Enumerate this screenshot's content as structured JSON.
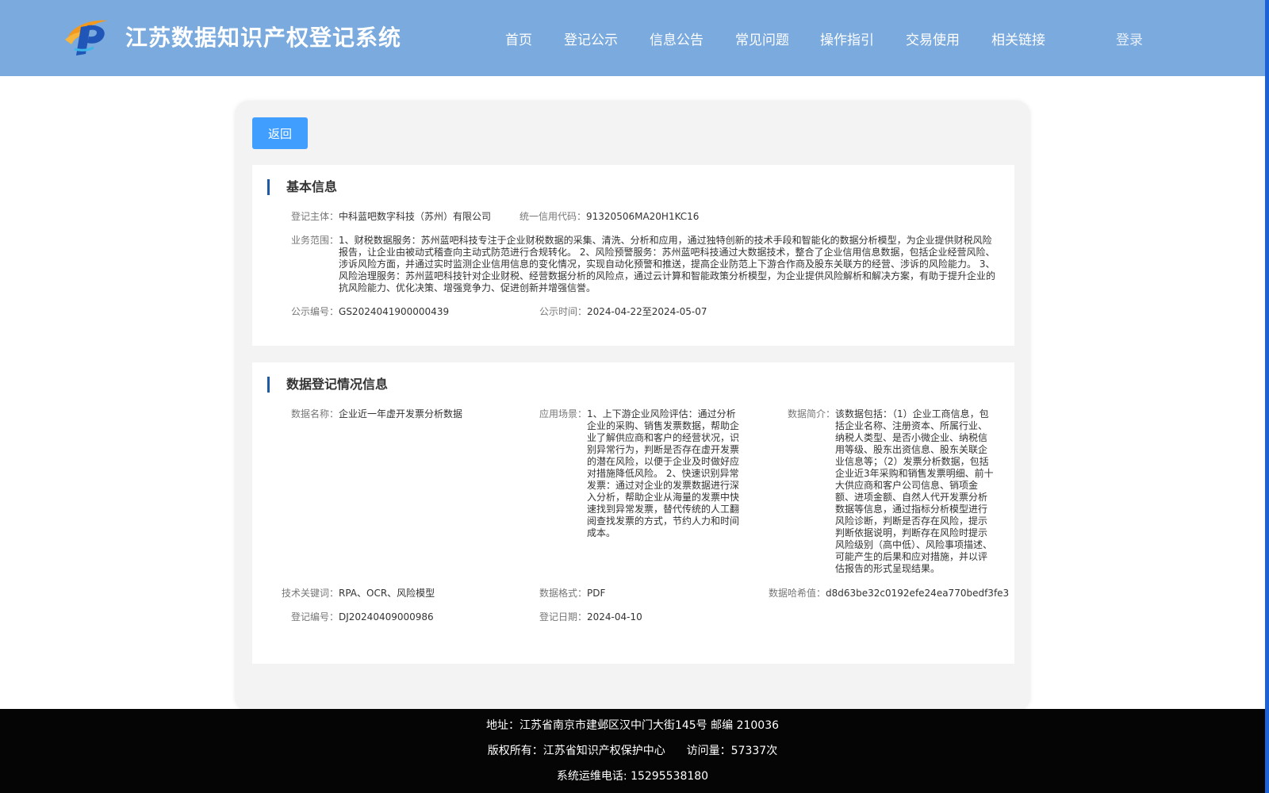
{
  "header": {
    "title": "江苏数据知识产权登记系统",
    "nav": [
      "首页",
      "登记公示",
      "信息公告",
      "常见问题",
      "操作指引",
      "交易使用",
      "相关链接"
    ],
    "login": "登录"
  },
  "back_label": "返回",
  "basic": {
    "section_title": "基本信息",
    "subject_label": "登记主体：",
    "subject_value": "中科蓝吧数字科技（苏州）有限公司",
    "credit_label": "统一信用代码：",
    "credit_value": "91320506MA20H1KC16",
    "scope_label": "业务范围：",
    "scope_value": "1、财税数据服务：苏州蓝吧科技专注于企业财税数据的采集、清洗、分析和应用，通过独特创新的技术手段和智能化的数据分析模型，为企业提供财税风险报告，让企业由被动式稽查向主动式防范进行合规转化。 2、风险预警服务：苏州蓝吧科技通过大数据技术，整合了企业信用信息数据，包括企业经营风险、涉诉风险方面，并通过实时监测企业信用信息的变化情况，实现自动化预警和推送，提高企业防范上下游合作商及股东关联方的经营、涉诉的风险能力。 3、风险治理服务：苏州蓝吧科技针对企业财税、经营数据分析的风险点，通过云计算和智能政策分析模型，为企业提供风险解析和解决方案，有助于提升企业的抗风险能力、优化决策、增强竞争力、促进创新并增强信誉。",
    "notice_no_label": "公示编号：",
    "notice_no_value": "GS2024041900000439",
    "notice_time_label": "公示时间：",
    "notice_time_value": "2024-04-22至2024-05-07"
  },
  "data": {
    "section_title": "数据登记情况信息",
    "name_label": "数据名称：",
    "name_value": "企业近一年虚开发票分析数据",
    "scene_label": "应用场景：",
    "scene_value": "1、上下游企业风险评估：通过分析企业的采购、销售发票数据，帮助企业了解供应商和客户的经营状况，识别异常行为，判断是否存在虚开发票的潜在风险，以便于企业及时做好应对措施降低风险。 2、快速识别异常发票：通过对企业的发票数据进行深入分析，帮助企业从海量的发票中快速找到异常发票，替代传统的人工翻阅查找发票的方式，节约人力和时间成本。",
    "intro_label": "数据简介：",
    "intro_value": "该数据包括：（1）企业工商信息，包括企业名称、注册资本、所属行业、纳税人类型、是否小微企业、纳税信用等级、股东出资信息、股东关联企业信息等；（2）发票分析数据，包括企业近3年采购和销售发票明细、前十大供应商和客户公司信息、销项金额、进项金额、自然人代开发票分析数据等信息，通过指标分析模型进行风险诊断，判断是否存在风险，提示判断依据说明，判断存在风险时提示风险级别（高中低）、风险事项描述、可能产生的后果和应对措施，并以评估报告的形式呈现结果。",
    "keywords_label": "技术关键词：",
    "keywords_value": "RPA、OCR、风险模型",
    "format_label": "数据格式：",
    "format_value": "PDF",
    "hash_label": "数据哈希值：",
    "hash_value": "d8d63be32c0192efe24ea770bedf3fe3",
    "reg_no_label": "登记编号：",
    "reg_no_value": "DJ20240409000986",
    "reg_date_label": "登记日期：",
    "reg_date_value": "2024-04-10"
  },
  "footer": {
    "address": "地址：江苏省南京市建邺区汉中门大街145号 邮编 210036",
    "copyright": "版权所有：江苏省知识产权保护中心",
    "visits": "访问量：57337次",
    "phone": "系统运维电话: 15295538180"
  },
  "colors": {
    "header_bg": "#7aaade",
    "button_bg": "#409eff",
    "title_bar": "#1f5aa6",
    "footer_bg": "#050505"
  }
}
